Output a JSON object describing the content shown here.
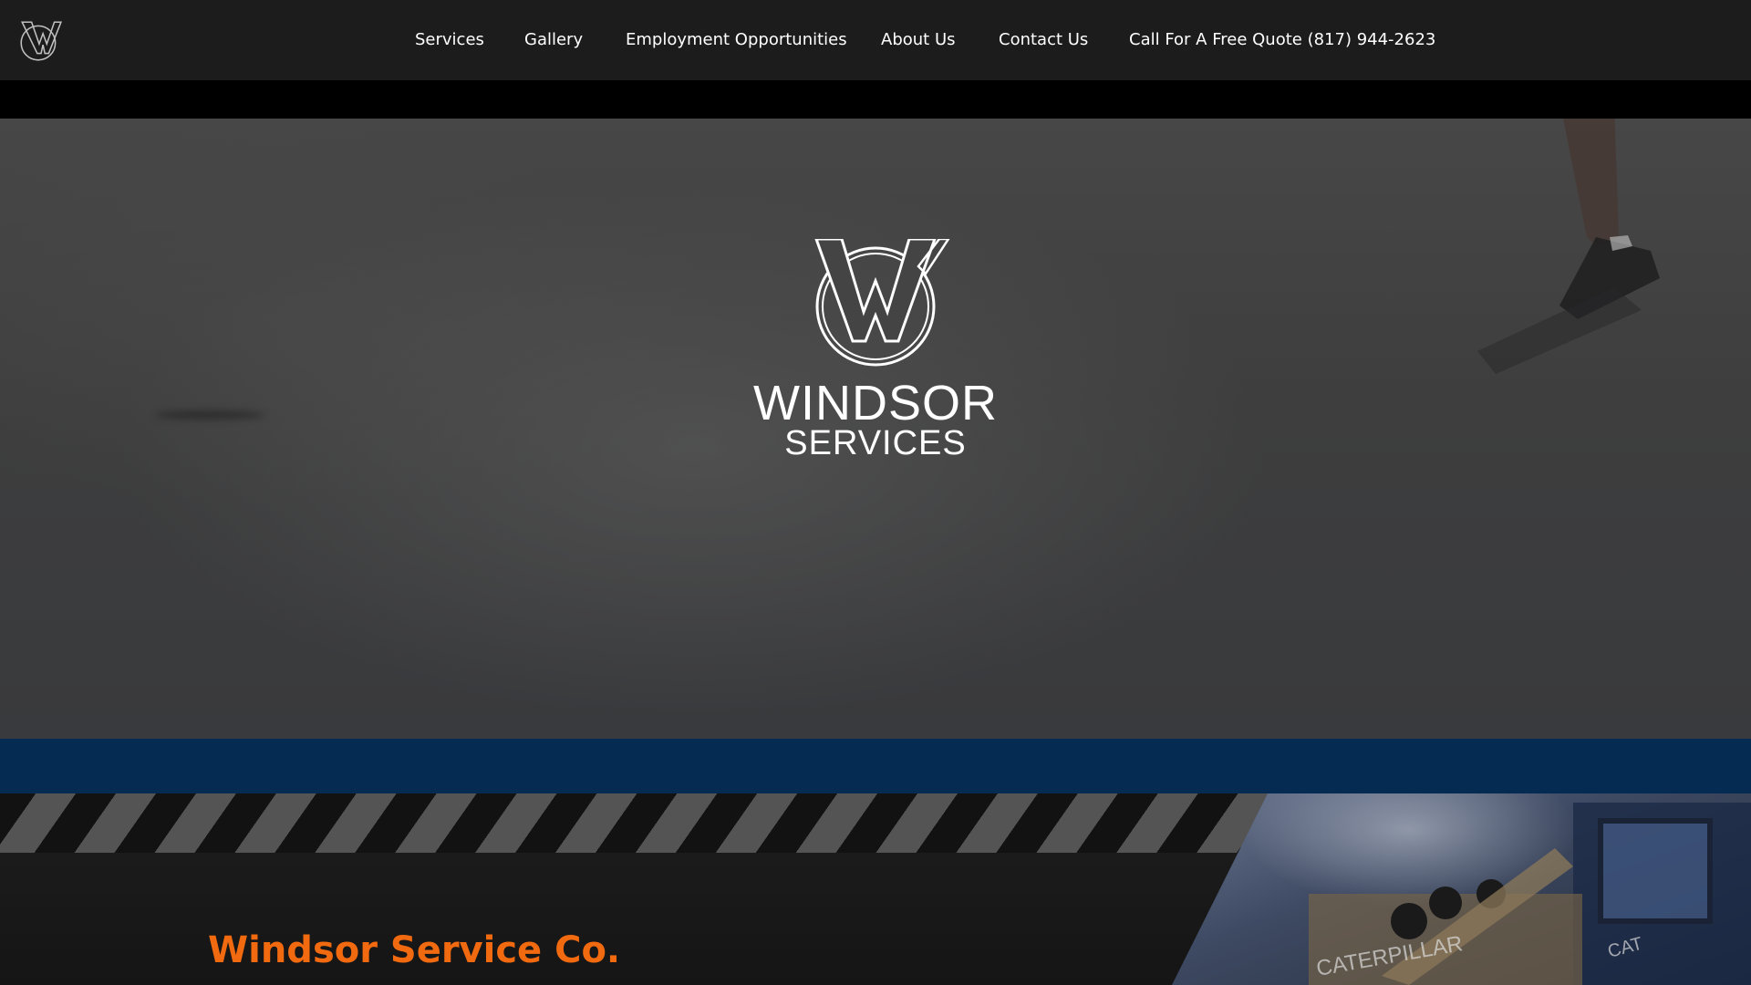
{
  "header": {
    "logo_icon": "windsor-wc-monogram-icon"
  },
  "nav": {
    "items": [
      {
        "label": "Services"
      },
      {
        "label": "Gallery"
      },
      {
        "label": "Employment Opportunities"
      },
      {
        "label": "About Us"
      },
      {
        "label": "Contact Us"
      },
      {
        "label": "Call For A Free Quote (817) 944-2623"
      }
    ]
  },
  "hero": {
    "logo_icon": "windsor-wc-monogram-icon",
    "title": "WINDSOR",
    "subtitle": "SERVICES"
  },
  "lower": {
    "company_name": "Windsor Service Co."
  },
  "colors": {
    "header_bg": "#1c1c1c",
    "accent_orange": "#f26a10",
    "band_blue": "#052b52",
    "text_white": "#ffffff"
  }
}
